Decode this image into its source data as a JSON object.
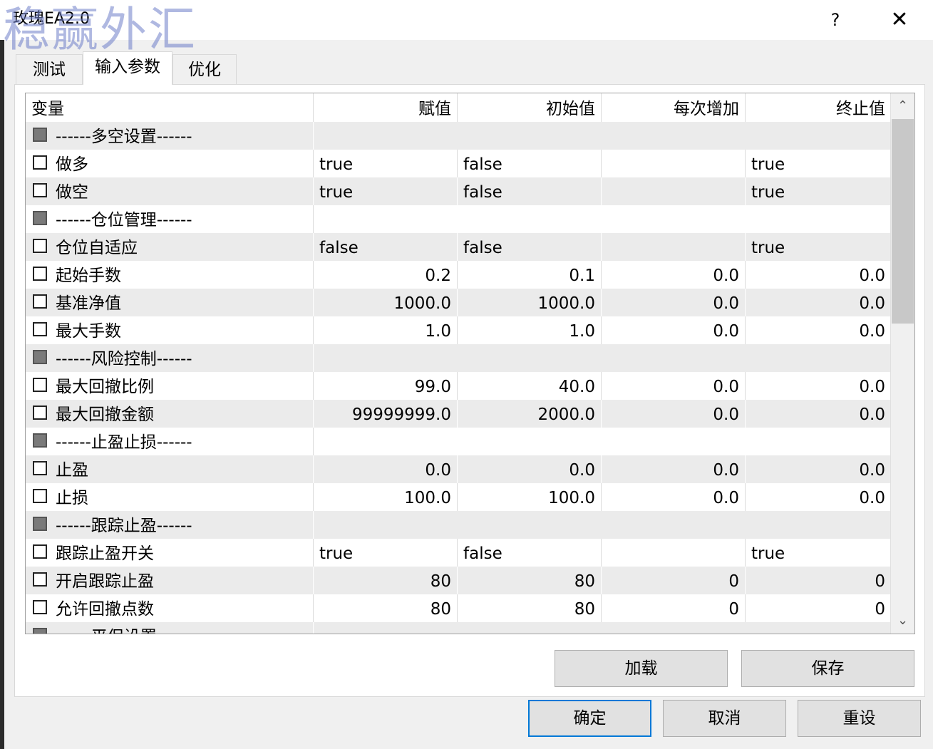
{
  "window": {
    "title": "玫瑰EA2.0",
    "watermark": "稳赢外汇",
    "help_label": "?",
    "close_label": "✕"
  },
  "tabs": [
    {
      "label": "测试"
    },
    {
      "label": "输入参数"
    },
    {
      "label": "优化"
    }
  ],
  "grid": {
    "headers": [
      "变量",
      "赋值",
      "初始值",
      "每次增加",
      "终止值"
    ],
    "rows": [
      {
        "section": true,
        "name": "------多空设置------"
      },
      {
        "name": "做多",
        "value": "true",
        "start": "false",
        "step": "",
        "stop": "true",
        "numeric": false
      },
      {
        "name": "做空",
        "value": "true",
        "start": "false",
        "step": "",
        "stop": "true",
        "numeric": false
      },
      {
        "section": true,
        "name": "------仓位管理------"
      },
      {
        "name": "仓位自适应",
        "value": "false",
        "start": "false",
        "step": "",
        "stop": "true",
        "numeric": false
      },
      {
        "name": "起始手数",
        "value": "0.2",
        "start": "0.1",
        "step": "0.0",
        "stop": "0.0",
        "numeric": true
      },
      {
        "name": "基准净值",
        "value": "1000.0",
        "start": "1000.0",
        "step": "0.0",
        "stop": "0.0",
        "numeric": true
      },
      {
        "name": "最大手数",
        "value": "1.0",
        "start": "1.0",
        "step": "0.0",
        "stop": "0.0",
        "numeric": true
      },
      {
        "section": true,
        "name": "------风险控制------"
      },
      {
        "name": "最大回撤比例",
        "value": "99.0",
        "start": "40.0",
        "step": "0.0",
        "stop": "0.0",
        "numeric": true
      },
      {
        "name": "最大回撤金额",
        "value": "99999999.0",
        "start": "2000.0",
        "step": "0.0",
        "stop": "0.0",
        "numeric": true
      },
      {
        "section": true,
        "name": "------止盈止损------"
      },
      {
        "name": "止盈",
        "value": "0.0",
        "start": "0.0",
        "step": "0.0",
        "stop": "0.0",
        "numeric": true
      },
      {
        "name": "止损",
        "value": "100.0",
        "start": "100.0",
        "step": "0.0",
        "stop": "0.0",
        "numeric": true
      },
      {
        "section": true,
        "name": "------跟踪止盈------"
      },
      {
        "name": "跟踪止盈开关",
        "value": "true",
        "start": "false",
        "step": "",
        "stop": "true",
        "numeric": false
      },
      {
        "name": "开启跟踪止盈",
        "value": "80",
        "start": "80",
        "step": "0",
        "stop": "0",
        "numeric": true
      },
      {
        "name": "允许回撤点数",
        "value": "80",
        "start": "80",
        "step": "0",
        "stop": "0",
        "numeric": true
      },
      {
        "section": true,
        "name": "------平保设置------"
      }
    ]
  },
  "scrollbar": {
    "up_icon": "⌃",
    "down_icon": "⌄"
  },
  "buttons": {
    "load": "加载",
    "save": "保存",
    "ok": "确定",
    "cancel": "取消",
    "reset": "重设"
  },
  "colors": {
    "accent": "#0078d7",
    "alt_row": "#ebebeb",
    "watermark": "#6e7dc8"
  }
}
